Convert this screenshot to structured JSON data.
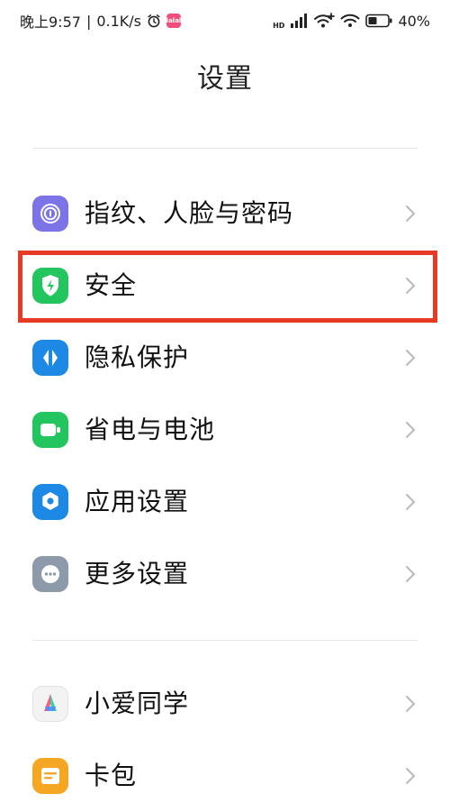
{
  "status_bar": {
    "time": "晚上9:57",
    "separator": "|",
    "speed": "0.1K/s",
    "app_badge": "lalal",
    "hd": "HD",
    "battery": "40%"
  },
  "page": {
    "title": "设置"
  },
  "sections": [
    {
      "items": [
        {
          "label": "指纹、人脸与密码",
          "icon": "fingerprint-icon",
          "color": "#7b73e6"
        },
        {
          "label": "安全",
          "icon": "shield-icon",
          "color": "#22c55e"
        },
        {
          "label": "隐私保护",
          "icon": "privacy-icon",
          "color": "#1e88e5"
        },
        {
          "label": "省电与电池",
          "icon": "battery-icon",
          "color": "#22c55e"
        },
        {
          "label": "应用设置",
          "icon": "gear-icon",
          "color": "#1e88e5"
        },
        {
          "label": "更多设置",
          "icon": "more-icon",
          "color": "#8c9aa9"
        }
      ]
    },
    {
      "items": [
        {
          "label": "小爱同学",
          "icon": "xiaoai-icon",
          "color": "#f3f3f3"
        },
        {
          "label": "卡包",
          "icon": "wallet-icon",
          "color": "#f5a623"
        }
      ]
    }
  ],
  "highlight": {
    "target": "安全",
    "color": "#e63a24"
  }
}
